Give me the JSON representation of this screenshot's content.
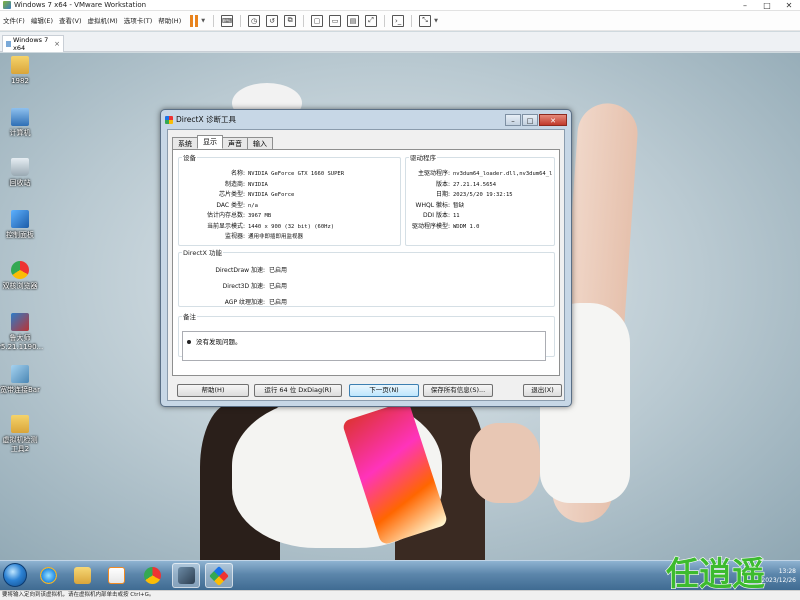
{
  "vmware": {
    "title": "Windows 7 x64 - VMware Workstation",
    "window_controls": {
      "minimize": "–",
      "maximize": "□",
      "close": "✕"
    },
    "menu": [
      "文件(F)",
      "编辑(E)",
      "查看(V)",
      "虚拟机(M)",
      "选项卡(T)",
      "帮助(H)"
    ],
    "toolbar_icons": [
      "pause-icon",
      "send-ctrl-alt-del-icon",
      "snapshot-icon",
      "revert-snapshot-icon",
      "snapshot-manager-icon",
      "full-screen-icon",
      "unity-icon",
      "console-icon",
      "stretch-icon"
    ],
    "tab": {
      "label": "Windows 7 x64",
      "close": "×"
    },
    "status": "要将输入定向到该虚拟机，请在虚拟机内部单击或按 Ctrl+G。"
  },
  "desktop": {
    "icons": [
      {
        "label": "1982",
        "icon": "folder-icon"
      },
      {
        "label": "计算机",
        "icon": "computer-icon"
      },
      {
        "label": "回收站",
        "icon": "recycle-bin-icon"
      },
      {
        "label": "控制面板",
        "icon": "control-panel-icon"
      },
      {
        "label": "双核浏览器",
        "icon": "chrome-icon"
      },
      {
        "label": "鲁大师 v5.21.1190...",
        "icon": "app-icon"
      },
      {
        "label": "宽带连接Bar",
        "icon": "network-icon"
      },
      {
        "label": "虚拟机检测工具2",
        "icon": "folder-icon"
      }
    ]
  },
  "dxdiag": {
    "title": "DirectX 诊断工具",
    "controls": {
      "minimize": "–",
      "maximize": "□",
      "close": "✕"
    },
    "tabs": [
      "系统",
      "显示",
      "声音",
      "输入"
    ],
    "active_tab": 1,
    "device": {
      "heading": "设备",
      "fields": [
        {
          "label": "名称:",
          "value": "NVIDIA GeForce GTX 1660 SUPER"
        },
        {
          "label": "制造商:",
          "value": "NVIDIA"
        },
        {
          "label": "芯片类型:",
          "value": "NVIDIA GeForce"
        },
        {
          "label": "DAC 类型:",
          "value": "n/a"
        },
        {
          "label": "估计内存总数:",
          "value": "3967 MB"
        },
        {
          "label": "当前显示模式:",
          "value": "1440 x 900 (32 bit) (60Hz)"
        },
        {
          "label": "监视器:",
          "value": "通用非即插即用监视器"
        }
      ]
    },
    "drivers": {
      "heading": "驱动程序",
      "fields": [
        {
          "label": "主驱动程序:",
          "value": "nv3dum64_loader.dll,nv3dum64_l"
        },
        {
          "label": "版本:",
          "value": "27.21.14.5654"
        },
        {
          "label": "日期:",
          "value": "2023/5/20 19:32:15"
        },
        {
          "label": "WHQL 徽标:",
          "value": "暂缺"
        },
        {
          "label": "DDI 版本:",
          "value": "11"
        },
        {
          "label": "驱动程序模型:",
          "value": "WDDM 1.0"
        }
      ]
    },
    "features": {
      "heading": "DirectX 功能",
      "fields": [
        {
          "label": "DirectDraw 加速:",
          "value": "已启用"
        },
        {
          "label": "Direct3D 加速:",
          "value": "已启用"
        },
        {
          "label": "AGP 纹理加速:",
          "value": "已启用"
        }
      ]
    },
    "notes": {
      "heading": "备注",
      "items": [
        "没有发现问题。"
      ]
    },
    "buttons": {
      "help": "帮助(H)",
      "run64": "运行 64 位 DxDiag(R)",
      "next": "下一页(N)",
      "save": "保存所有信息(S)...",
      "exit": "退出(X)"
    }
  },
  "taskbar": {
    "apps": [
      {
        "name": "ie-icon",
        "active": false
      },
      {
        "name": "explorer-icon",
        "active": false
      },
      {
        "name": "media-player-icon",
        "active": false
      },
      {
        "name": "chrome-icon",
        "active": false
      },
      {
        "name": "app-icon",
        "active": true
      },
      {
        "name": "dxdiag-icon",
        "active": true
      }
    ],
    "tray_time": "13:28",
    "tray_date": "2023/12/26"
  },
  "watermark": {
    "text": "任逍遥"
  }
}
